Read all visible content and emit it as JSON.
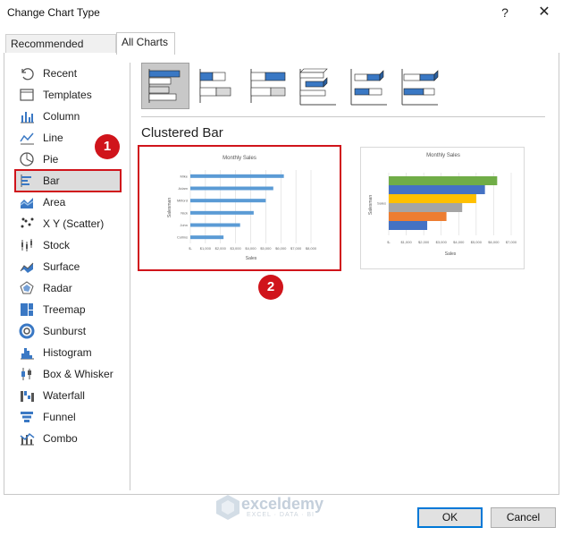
{
  "window": {
    "title": "Change Chart Type",
    "help": "?",
    "close": "✕"
  },
  "tabs": [
    {
      "label": "Recommended Charts",
      "active": false
    },
    {
      "label": "All Charts",
      "active": true
    }
  ],
  "categories": [
    {
      "label": "Recent",
      "icon": "recent-icon"
    },
    {
      "label": "Templates",
      "icon": "templates-icon"
    },
    {
      "label": "Column",
      "icon": "column-chart-icon"
    },
    {
      "label": "Line",
      "icon": "line-chart-icon"
    },
    {
      "label": "Pie",
      "icon": "pie-chart-icon"
    },
    {
      "label": "Bar",
      "icon": "bar-chart-icon",
      "selected": true
    },
    {
      "label": "Area",
      "icon": "area-chart-icon"
    },
    {
      "label": "X Y (Scatter)",
      "icon": "scatter-chart-icon"
    },
    {
      "label": "Stock",
      "icon": "stock-chart-icon"
    },
    {
      "label": "Surface",
      "icon": "surface-chart-icon"
    },
    {
      "label": "Radar",
      "icon": "radar-chart-icon"
    },
    {
      "label": "Treemap",
      "icon": "treemap-chart-icon"
    },
    {
      "label": "Sunburst",
      "icon": "sunburst-chart-icon"
    },
    {
      "label": "Histogram",
      "icon": "histogram-chart-icon"
    },
    {
      "label": "Box & Whisker",
      "icon": "box-whisker-chart-icon"
    },
    {
      "label": "Waterfall",
      "icon": "waterfall-chart-icon"
    },
    {
      "label": "Funnel",
      "icon": "funnel-chart-icon"
    },
    {
      "label": "Combo",
      "icon": "combo-chart-icon"
    }
  ],
  "badges": {
    "one": "1",
    "two": "2"
  },
  "subtypes": [
    {
      "name": "clustered-bar-subtype-icon",
      "selected": true
    },
    {
      "name": "stacked-bar-subtype-icon"
    },
    {
      "name": "100-stacked-bar-subtype-icon"
    },
    {
      "name": "3d-clustered-bar-subtype-icon"
    },
    {
      "name": "3d-stacked-bar-subtype-icon"
    },
    {
      "name": "3d-100-stacked-bar-subtype-icon"
    }
  ],
  "section_title": "Clustered Bar",
  "chart_data": [
    {
      "type": "bar",
      "title": "Monthly Sales",
      "xlabel": "Sales",
      "ylabel": "Salesman",
      "categories": [
        "Mike",
        "Adam",
        "Milford",
        "Nick",
        "John",
        "Collins"
      ],
      "values": [
        6200,
        5500,
        5000,
        4200,
        3300,
        2200
      ],
      "xticks": [
        "$-",
        "$1,000",
        "$2,000",
        "$3,000",
        "$4,000",
        "$5,000",
        "$6,000",
        "$7,000",
        "$8,000"
      ],
      "xlim": [
        0,
        8000
      ],
      "color": "#5b9bd5"
    },
    {
      "type": "bar",
      "title": "Monthly Sales",
      "xlabel": "Sales",
      "ylabel": "Salesman",
      "categories": [
        "Sales"
      ],
      "series": [
        {
          "values": [
            2200
          ],
          "color": "#4472c4"
        },
        {
          "values": [
            3300
          ],
          "color": "#ed7d31"
        },
        {
          "values": [
            4200
          ],
          "color": "#a5a5a5"
        },
        {
          "values": [
            5000
          ],
          "color": "#ffc000"
        },
        {
          "values": [
            5500
          ],
          "color": "#4472c4"
        },
        {
          "values": [
            6200
          ],
          "color": "#70ad47"
        }
      ],
      "xticks": [
        "$-",
        "$1,000",
        "$2,000",
        "$3,000",
        "$4,000",
        "$5,000",
        "$6,000",
        "$7,000"
      ],
      "xlim": [
        0,
        7000
      ]
    }
  ],
  "watermark": {
    "name": "exceldemy",
    "tagline": "EXCEL · DATA · BI"
  },
  "buttons": {
    "ok": "OK",
    "cancel": "Cancel"
  }
}
